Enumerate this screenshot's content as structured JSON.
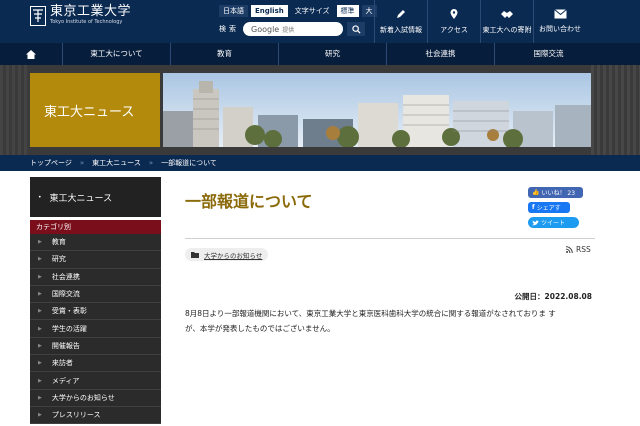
{
  "header": {
    "logo_jp": "東京工業大学",
    "logo_en": "Tokyo Institute of Technology",
    "lang_ja": "日本語",
    "lang_en": "English",
    "font_size_label": "文字サイズ",
    "font_std": "標準",
    "font_large": "大",
    "search_label": "検索",
    "search_google": "Google",
    "search_placeholder": "提供",
    "quick_links": [
      {
        "label": "新着入試情報",
        "icon": "pencil-icon"
      },
      {
        "label": "アクセス",
        "icon": "map-pin-icon"
      },
      {
        "label": "東工大への寄附",
        "icon": "handshake-icon"
      },
      {
        "label": "お問い合わせ",
        "icon": "mail-icon"
      }
    ]
  },
  "gnav": {
    "items": [
      "東工大について",
      "教育",
      "研究",
      "社会連携",
      "国際交流"
    ]
  },
  "hero": {
    "title": "東工大ニュース"
  },
  "breadcrumb": [
    "トップページ",
    "東工大ニュース",
    "一部報道について"
  ],
  "sidebar": {
    "heading": "東工大ニュース",
    "category_label": "カテゴリ別",
    "items": [
      "教育",
      "研究",
      "社会連携",
      "国際交流",
      "受賞・表彰",
      "学生の活躍",
      "開催報告",
      "来訪者",
      "メディア",
      "大学からのお知らせ",
      "プレスリリース"
    ]
  },
  "article": {
    "title": "一部報道について",
    "like_label": "いいね！ 23",
    "share_label": "シェアす",
    "tweet_label": "ツイート",
    "tag": "大学からのお知らせ",
    "rss": "RSS",
    "published": "公開日：2022.08.08",
    "body_line1": "8月8日より一部報道機関において、東京工業大学と東京医科歯科大学の統合に関する報道がなされておりま す",
    "body_line2": "が、本学が発表したものではございません。"
  },
  "colors": {
    "navy": "#0b2a52",
    "gold": "#b48a0d",
    "title_gold": "#8b6a0a",
    "category_red": "#7a0e1b"
  }
}
